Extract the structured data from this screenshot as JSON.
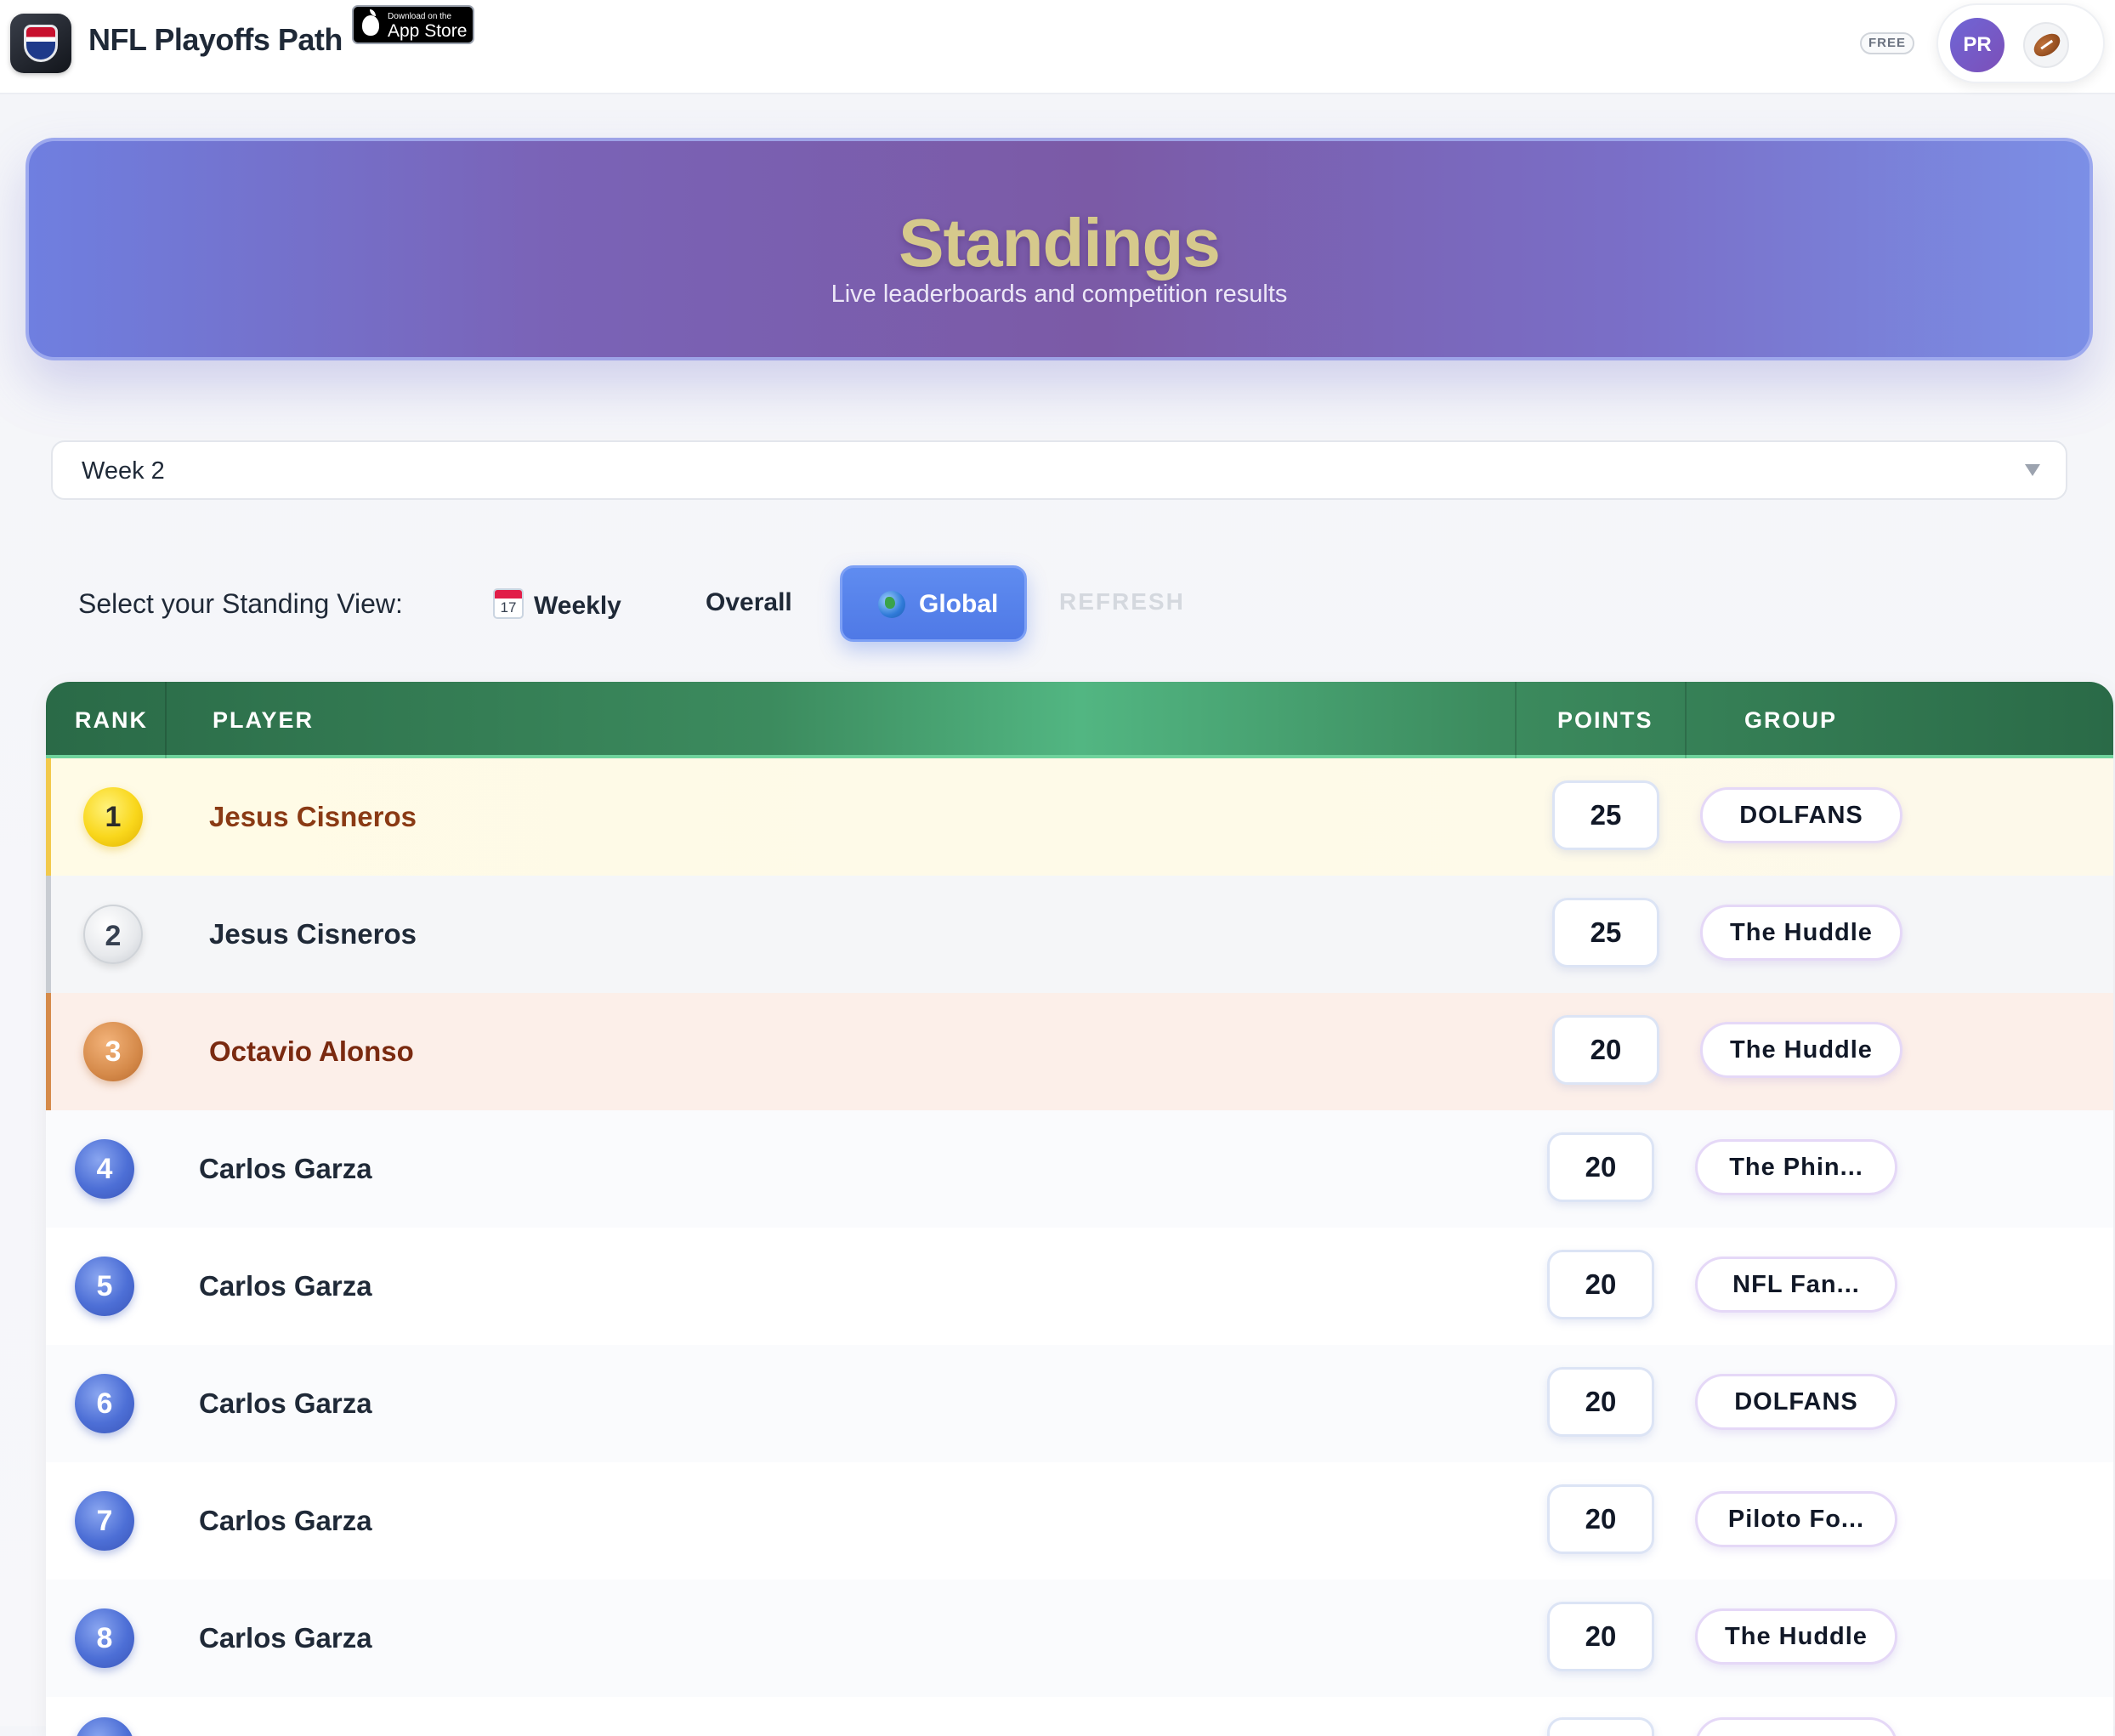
{
  "app": {
    "title": "NFL Playoffs Path",
    "app_store_small": "Download on the",
    "app_store_big": "App Store",
    "plan_badge": "FREE",
    "avatar_initials": "PR"
  },
  "hero": {
    "title": "Standings",
    "subtitle": "Live leaderboards and competition results"
  },
  "week_select": {
    "value": "Week 2"
  },
  "view_switcher": {
    "label": "Select your Standing View:",
    "weekly": "Weekly",
    "overall": "Overall",
    "global": "Global",
    "refresh": "REFRESH",
    "active": "global"
  },
  "table": {
    "headers": {
      "rank": "RANK",
      "player": "PLAYER",
      "points": "POINTS",
      "group": "GROUP"
    },
    "rows": [
      {
        "rank": "1",
        "player": "Jesus Cisneros",
        "points": "25",
        "group": "DOLFANS"
      },
      {
        "rank": "2",
        "player": "Jesus Cisneros",
        "points": "25",
        "group": "The Huddle"
      },
      {
        "rank": "3",
        "player": "Octavio Alonso",
        "points": "20",
        "group": "The Huddle"
      },
      {
        "rank": "4",
        "player": "Carlos Garza",
        "points": "20",
        "group": "The Phin..."
      },
      {
        "rank": "5",
        "player": "Carlos Garza",
        "points": "20",
        "group": "NFL Fan..."
      },
      {
        "rank": "6",
        "player": "Carlos Garza",
        "points": "20",
        "group": "DOLFANS"
      },
      {
        "rank": "7",
        "player": "Carlos Garza",
        "points": "20",
        "group": "Piloto Fo..."
      },
      {
        "rank": "8",
        "player": "Carlos Garza",
        "points": "20",
        "group": "The Huddle"
      }
    ]
  },
  "colors": {
    "hero_gradient": [
      "#6f7fe0",
      "#7b5aa6",
      "#7b8fe6"
    ],
    "table_header_green": "#3c8b5e",
    "active_button_blue": "#4f79e6",
    "gold": "#f9d71c",
    "silver": "#c9cdd3",
    "bronze": "#d58a4a"
  },
  "icons": [
    "app-logo-icon",
    "apple-icon",
    "football-icon",
    "calendar-icon",
    "globe-icon",
    "chevron-down-icon"
  ]
}
